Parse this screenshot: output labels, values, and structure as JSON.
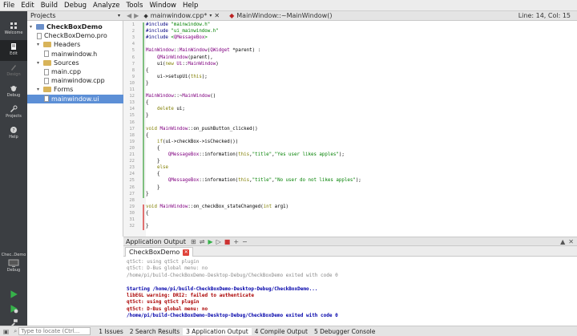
{
  "menubar": [
    "File",
    "Edit",
    "Build",
    "Debug",
    "Analyze",
    "Tools",
    "Window",
    "Help"
  ],
  "modes": [
    "Welcome",
    "Edit",
    "Design",
    "Debug",
    "Projects",
    "Help"
  ],
  "target": {
    "name": "Chec..Demo",
    "mode": "Debug"
  },
  "projects": {
    "selector": "Projects",
    "tree": [
      {
        "label": "CheckBoxDemo",
        "indent": 0,
        "kind": "project"
      },
      {
        "label": "CheckBoxDemo.pro",
        "indent": 1,
        "kind": "file"
      },
      {
        "label": "Headers",
        "indent": 1,
        "kind": "folder"
      },
      {
        "label": "mainwindow.h",
        "indent": 2,
        "kind": "file"
      },
      {
        "label": "Sources",
        "indent": 1,
        "kind": "folder"
      },
      {
        "label": "main.cpp",
        "indent": 2,
        "kind": "file"
      },
      {
        "label": "mainwindow.cpp",
        "indent": 2,
        "kind": "file"
      },
      {
        "label": "Forms",
        "indent": 1,
        "kind": "folder"
      },
      {
        "label": "mainwindow.ui",
        "indent": 2,
        "kind": "file",
        "selected": true
      }
    ]
  },
  "editor": {
    "file": "mainwindow.cpp*",
    "symbol": "MainWindow::~MainWindow()",
    "position": "Line: 14, Col: 15",
    "lines": [
      "#include \"mainwindow.h\"",
      "#include \"ui_mainwindow.h\"",
      "#include <QMessageBox>",
      "",
      "MainWindow::MainWindow(QWidget *parent) :",
      "    QMainWindow(parent),",
      "    ui(new Ui::MainWindow)",
      "{",
      "    ui->setupUi(this);",
      "}",
      "",
      "MainWindow::~MainWindow()",
      "{",
      "    delete ui;",
      "}",
      "",
      "void MainWindow::on_pushButton_clicked()",
      "{",
      "    if(ui->checkBox->isChecked())",
      "    {",
      "        QMessageBox::information(this,\"title\",\"Yes user likes apples\");",
      "    }",
      "    else",
      "    {",
      "        QMessageBox::information(this,\"title\",\"No user do not likes apples\");",
      "    }",
      "}",
      "",
      "void MainWindow::on_checkBox_stateChanged(int arg1)",
      "{",
      "",
      "}"
    ]
  },
  "output": {
    "title": "Application Output",
    "tab": "CheckBoxDemo",
    "lines": [
      {
        "text": "qt5ct: using qt5ct plugin",
        "color": "#888888"
      },
      {
        "text": "qt5ct: D-Bus global menu: no",
        "color": "#888888"
      },
      {
        "text": "/home/pi/build-CheckBoxDemo-Desktop-Debug/CheckBoxDemo exited with code 0",
        "color": "#888888"
      },
      {
        "text": "",
        "color": "#000000"
      },
      {
        "text": "Starting /home/pi/build-CheckBoxDemo-Desktop-Debug/CheckBoxDemo...",
        "color": "#0000aa"
      },
      {
        "text": "libEGL warning: DRI2: failed to authenticate",
        "color": "#aa0000"
      },
      {
        "text": "qt5ct: using qt5ct plugin",
        "color": "#aa0000"
      },
      {
        "text": "qt5ct: D-Bus global menu: no",
        "color": "#aa0000"
      },
      {
        "text": "/home/pi/build-CheckBoxDemo-Desktop-Debug/CheckBoxDemo exited with code 0",
        "color": "#0000aa"
      }
    ]
  },
  "statusbar": {
    "locator_placeholder": "Type to locate (Ctrl...",
    "tabs": [
      "1 Issues",
      "2 Search Results",
      "3 Application Output",
      "4 Compile Output",
      "5 Debugger Console"
    ]
  }
}
